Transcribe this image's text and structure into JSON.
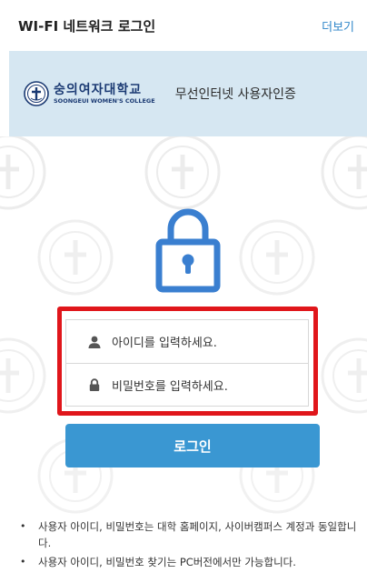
{
  "header": {
    "title": "WI-FI 네트워크 로그인",
    "more_label": "더보기"
  },
  "banner": {
    "school_name_kr": "숭의여자대학교",
    "school_name_en": "SOONGEUI WOMEN'S COLLEGE",
    "service_title": "무선인터넷 사용자인증"
  },
  "form": {
    "user_placeholder": "아이디를 입력하세요.",
    "password_placeholder": "비밀번호를 입력하세요.",
    "login_label": "로그인"
  },
  "notes": [
    "사용자 아이디, 비밀번호는 대학 홈페이지, 사이버캠퍼스 계정과 동일합니다.",
    "사용자 아이디, 비밀번호 찾기는 PC버전에서만 가능합니다."
  ],
  "icons": {
    "lock": "lock-icon",
    "user": "user-icon",
    "password": "lock-small-icon",
    "emblem": "school-emblem-icon"
  },
  "colors": {
    "accent": "#3a97d2",
    "link": "#2f86c9",
    "banner_bg": "#d6e7f2",
    "brand_text": "#1b3a73",
    "highlight": "#e0161b"
  }
}
